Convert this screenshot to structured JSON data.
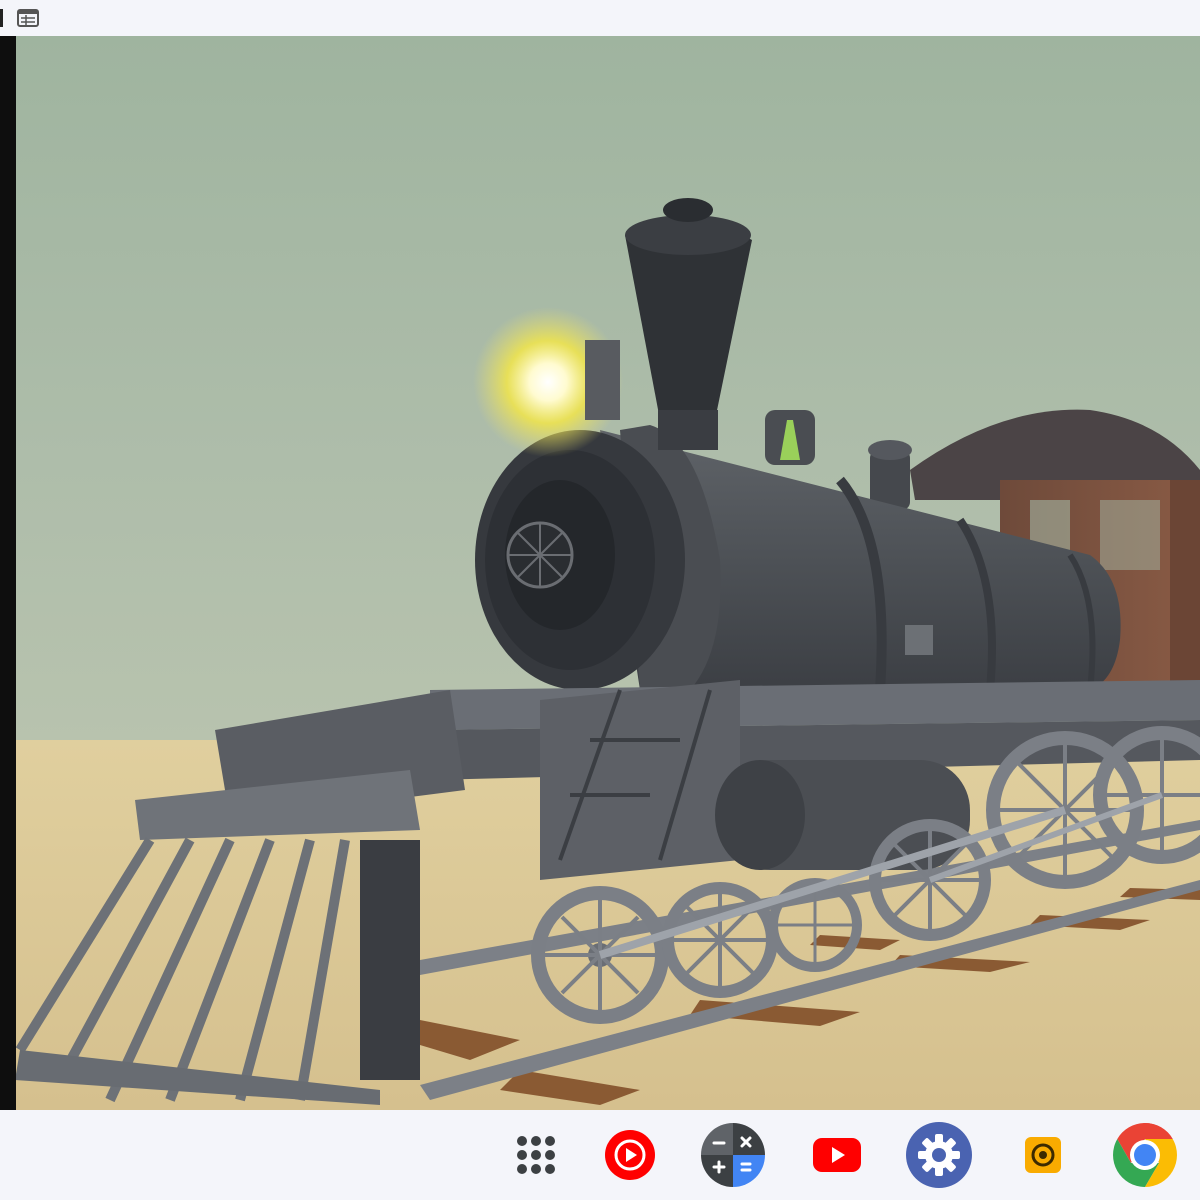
{
  "window": {
    "title_icon": "window-icon"
  },
  "scene": {
    "description_icon": "steam-locomotive-3d-scene",
    "sky_color": "#a9b9a6",
    "sand_color": "#d8c594",
    "locomotive_color": "#55585e",
    "headlight_color": "#fff27a",
    "rail_color": "#7c8087",
    "sleeper_color": "#8a5a33"
  },
  "shelf": {
    "apps": [
      {
        "name": "launcher",
        "icon": "launcher-grid-icon"
      },
      {
        "name": "youtube-music",
        "icon": "youtube-music-icon",
        "color": "#ff0000"
      },
      {
        "name": "calculator",
        "icon": "calculator-icon",
        "color": "#5f6368"
      },
      {
        "name": "youtube",
        "icon": "youtube-icon",
        "color": "#ff0000"
      },
      {
        "name": "settings",
        "icon": "settings-gear-icon",
        "color": "#4a63b1"
      },
      {
        "name": "camera",
        "icon": "camera-icon",
        "color": "#f9ab00"
      },
      {
        "name": "chrome",
        "icon": "chrome-icon",
        "color": "#4285f4"
      }
    ]
  }
}
